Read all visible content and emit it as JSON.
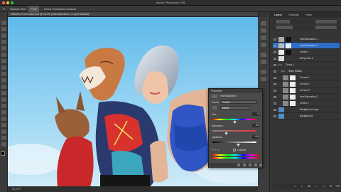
{
  "app": {
    "title": "Adobe Photoshop CS6"
  },
  "options_bar": {
    "sample_size_label": "Sample Size:",
    "sample_size_value": "Point",
    "show_transform": "Show Transform Controls"
  },
  "document": {
    "tab_title": "artifacts of ours ward.psd @ 33.3% (Hue/Saturation 1, Layer Mask/8) *",
    "status": "33.33%"
  },
  "panels": {
    "tabs": [
      "Layers",
      "Channels",
      "Paths"
    ]
  },
  "layers": [
    {
      "name": "Hue/Saturation 1"
    },
    {
      "name": "Hue/Saturation 2"
    },
    {
      "name": "Levels 1"
    },
    {
      "name": "BW-profile 2"
    },
    {
      "name": "Group 1"
    },
    {
      "name": "Warp Masks"
    },
    {
      "name": "Curves 1"
    },
    {
      "name": "Curves 2"
    },
    {
      "name": "Curves 3"
    },
    {
      "name": "Hue/Saturation 3"
    },
    {
      "name": "Levels 2"
    },
    {
      "name": "Background copy"
    },
    {
      "name": "Background"
    }
  ],
  "properties": {
    "title": "Properties",
    "panel_name": "Hue/Saturation",
    "preset_label": "Preset:",
    "preset_value": "Custom",
    "channel_value": "Master",
    "hue_label": "Hue:",
    "hue_value": "0",
    "saturation_label": "Saturation:",
    "saturation_value": "-40",
    "lightness_label": "Lightness:",
    "lightness_value": "+15",
    "colorize_label": "Colorize"
  },
  "colors": {
    "accent": "#2d6fc8",
    "ui_dark": "#3a3a3a",
    "sky": "#8fd0f0"
  }
}
